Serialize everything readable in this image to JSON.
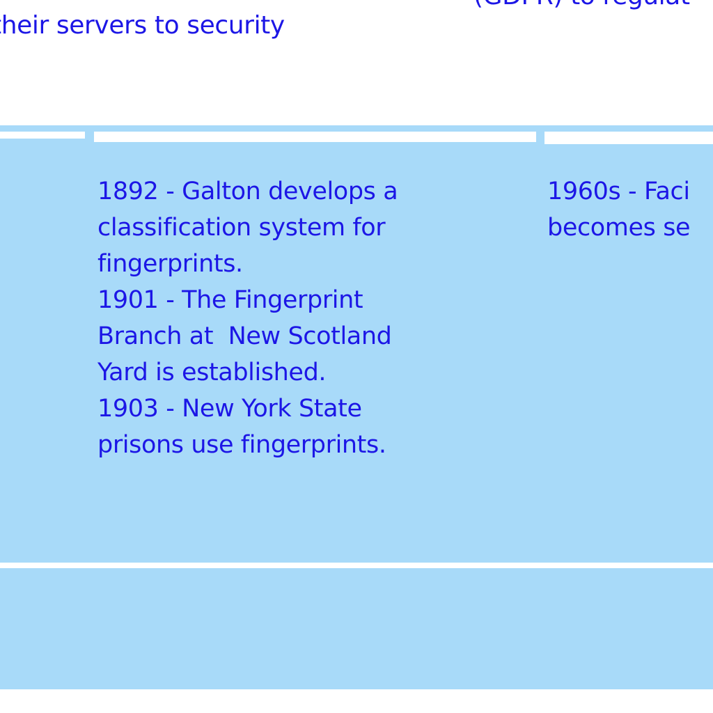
{
  "top_text": {
    "left_fragment": "their servers to security",
    "right_fragment": "(GDPR) to regulat"
  },
  "timeline": {
    "column_1": "1892 - Galton develops a\nclassification system for\nfingerprints.\n1901 - The Fingerprint\nBranch at  New Scotland\nYard is established.\n1903 - New York State\nprisons use fingerprints.",
    "column_2": "1960s - Faci\nbecomes se"
  },
  "colors": {
    "text_blue": "#1c16e6",
    "panel_blue": "#a8daf9",
    "background": "#ffffff"
  }
}
